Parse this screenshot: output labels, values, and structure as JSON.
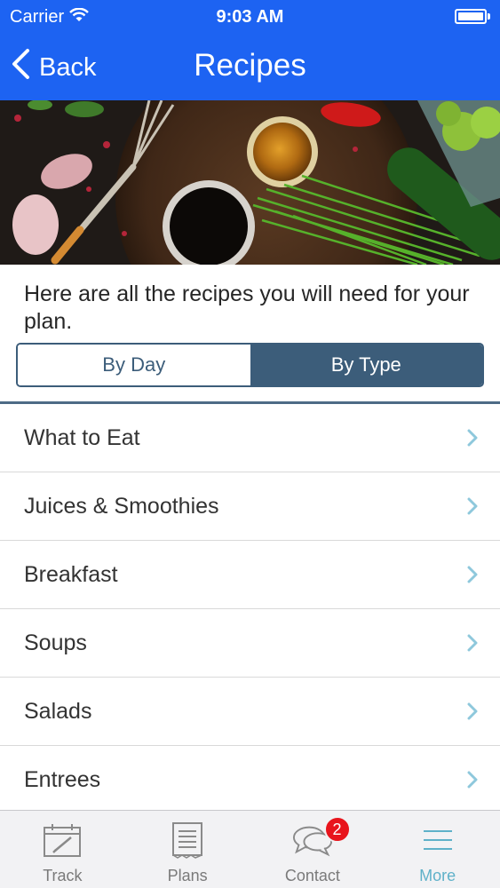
{
  "status_bar": {
    "carrier": "Carrier",
    "time": "9:03 AM"
  },
  "nav": {
    "back_label": "Back",
    "title": "Recipes"
  },
  "intro_text": "Here are all the recipes you will need for your plan.",
  "segments": {
    "by_day": "By Day",
    "by_type": "By Type",
    "selected": "By Type"
  },
  "categories": [
    {
      "label": "What to Eat"
    },
    {
      "label": "Juices & Smoothies"
    },
    {
      "label": "Breakfast"
    },
    {
      "label": "Soups"
    },
    {
      "label": "Salads"
    },
    {
      "label": "Entrees"
    }
  ],
  "tabs": [
    {
      "label": "Track",
      "icon": "calendar-icon"
    },
    {
      "label": "Plans",
      "icon": "notepad-icon"
    },
    {
      "label": "Contact",
      "icon": "chat-bubbles-icon",
      "badge": "2"
    },
    {
      "label": "More",
      "icon": "hamburger-menu-icon",
      "active": true
    }
  ],
  "colors": {
    "nav_blue": "#1d63f2",
    "segment_navy": "#3c5d7a",
    "chevron_teal": "#8ec8dc",
    "active_tab": "#5fb1c9",
    "badge_red": "#e8141c"
  }
}
